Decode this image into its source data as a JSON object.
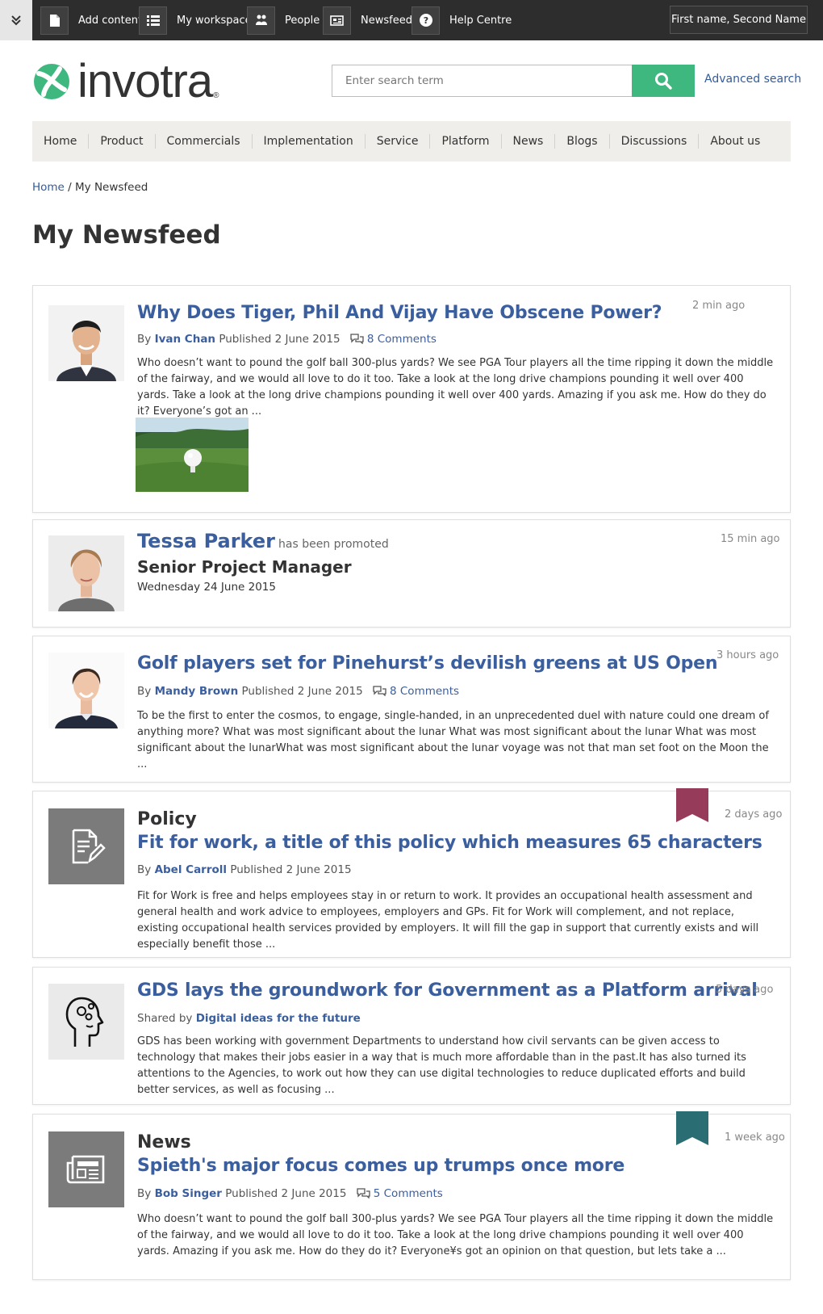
{
  "topbar": {
    "items": [
      {
        "label": "Add content",
        "icon": "document-icon"
      },
      {
        "label": "My workspace",
        "icon": "list-icon"
      },
      {
        "label": "People",
        "icon": "people-icon"
      },
      {
        "label": "Newsfeed",
        "icon": "newspaper-icon"
      },
      {
        "label": "Help Centre",
        "icon": "question-icon"
      }
    ],
    "user": "First name, Second Name"
  },
  "header": {
    "logo_text": "invotra",
    "logo_reg": "®",
    "search_placeholder": "Enter search term",
    "advanced_search": "Advanced search"
  },
  "nav": [
    "Home",
    "Product",
    "Commercials",
    "Implementation",
    "Service",
    "Platform",
    "News",
    "Blogs",
    "Discussions",
    "About us"
  ],
  "breadcrumb": {
    "home": "Home",
    "separator": " / ",
    "current": "My Newsfeed"
  },
  "page_title": "My Newsfeed",
  "feed": [
    {
      "title": "Why Does Tiger, Phil And Vijay Have Obscene Power?",
      "by": "By",
      "author": "Ivan Chan",
      "published": "Published 2 June 2015",
      "comments": "8 Comments",
      "excerpt": "Who doesn’t want to pound the golf ball 300-plus yards? We see PGA Tour players all the time ripping it down the middle of the fairway, and we would all love to do it too. Take a look at the long drive champions pounding it well over 400 yards.  Take a look at the long drive champions pounding it well over 400 yards. Amazing if you ask me. How do they do it? Everyone’s got an ...",
      "time": "2 min ago"
    },
    {
      "name": "Tessa Parker",
      "action": "has been promoted",
      "role": "Senior Project Manager",
      "date": "Wednesday 24 June 2015",
      "time": "15 min ago"
    },
    {
      "title": "Golf players set for Pinehurst’s devilish greens at US Open",
      "by": "By",
      "author": "Mandy Brown",
      "published": "Published 2 June 2015",
      "comments": "8 Comments",
      "excerpt": "To be the first to enter the cosmos, to engage, single-handed, in an unprecedented duel with nature could one dream of anything more?  What was most significant about the lunar What was most significant about the lunar What was most significant about the lunarWhat was most significant about the lunar voyage was not that man set foot on the Moon the ...",
      "time": "3 hours ago"
    },
    {
      "type": "Policy",
      "title": "Fit for work, a title of this policy which measures 65 characters",
      "by": "By",
      "author": "Abel Carroll",
      "published": "Published 2 June 2015",
      "excerpt": "Fit for Work is free and helps employees stay in or return to work. It provides an occupational health assessment and general health and work advice to employees, employers and GPs. Fit for Work will complement, and not replace, existing occupational health services provided by employers. It will fill the gap in support that currently exists and will especially benefit those ...",
      "time": "2 days ago",
      "bookmark_color": "#963b5a"
    },
    {
      "title": "GDS lays the groundwork for Government as a Platform arrival",
      "shared_by": "Shared by",
      "group": "Digital ideas for the future",
      "excerpt": "GDS has been working with government Departments to understand how civil servants can be given access to technology that makes their jobs easier in a way that is much more affordable than in the past.It has also turned its attentions to the Agencies, to work out how they can use digital technologies to reduce duplicated efforts and build better services, as well as focusing ...",
      "time": "5 days ago"
    },
    {
      "type": "News",
      "title": "Spieth's major focus comes up trumps once more",
      "by": "By",
      "author": "Bob Singer",
      "published": "Published 2 June 2015",
      "comments": "5 Comments",
      "excerpt": "Who doesn’t want to pound the golf ball 300-plus yards? We see PGA Tour players all the time ripping it down the middle of the fairway, and we would all love to do it too. Take a look at the long drive champions pounding it well over 400 yards. Amazing if you ask me. How do they do it? Everyone¥s got an opinion on that question, but lets take a ...",
      "time": "1 week ago",
      "bookmark_color": "#2a6d72"
    }
  ],
  "colors": {
    "accent": "#3fb87f",
    "link": "#3b5f9e",
    "topbar": "#2d2d2d",
    "nav_bg": "#efeeea"
  }
}
